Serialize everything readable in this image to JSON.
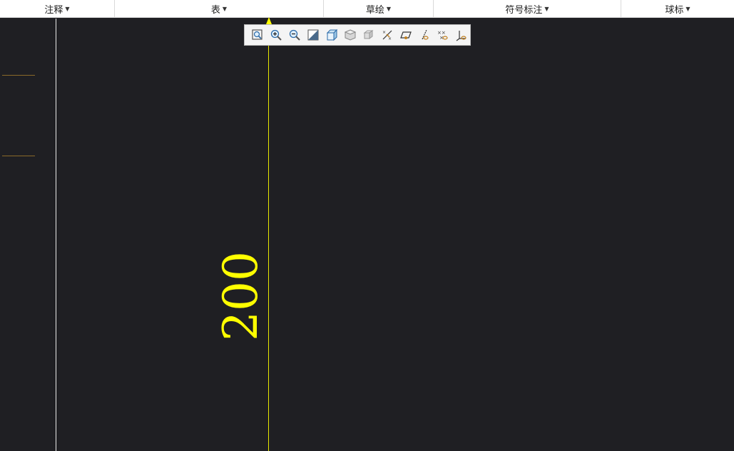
{
  "menubar": {
    "items": [
      {
        "label": "注释",
        "width": 0
      },
      {
        "label": "表"
      },
      {
        "label": "草绘"
      },
      {
        "label": "符号标注"
      },
      {
        "label": "球标"
      }
    ]
  },
  "drawing": {
    "dimension_value": "200",
    "dimension_color": "#ffff00",
    "border_color": "#e8e8e8",
    "background": "#1f1f23"
  },
  "view_toolbar": {
    "tools": [
      "refit-icon",
      "zoom-in-icon",
      "zoom-out-icon",
      "repaint-icon",
      "display-style-icon",
      "saved-orientations-icon",
      "named-views-icon",
      "datum-display-icon",
      "plane-display-icon",
      "axis-display-icon",
      "point-display-icon",
      "csys-display-icon"
    ]
  }
}
